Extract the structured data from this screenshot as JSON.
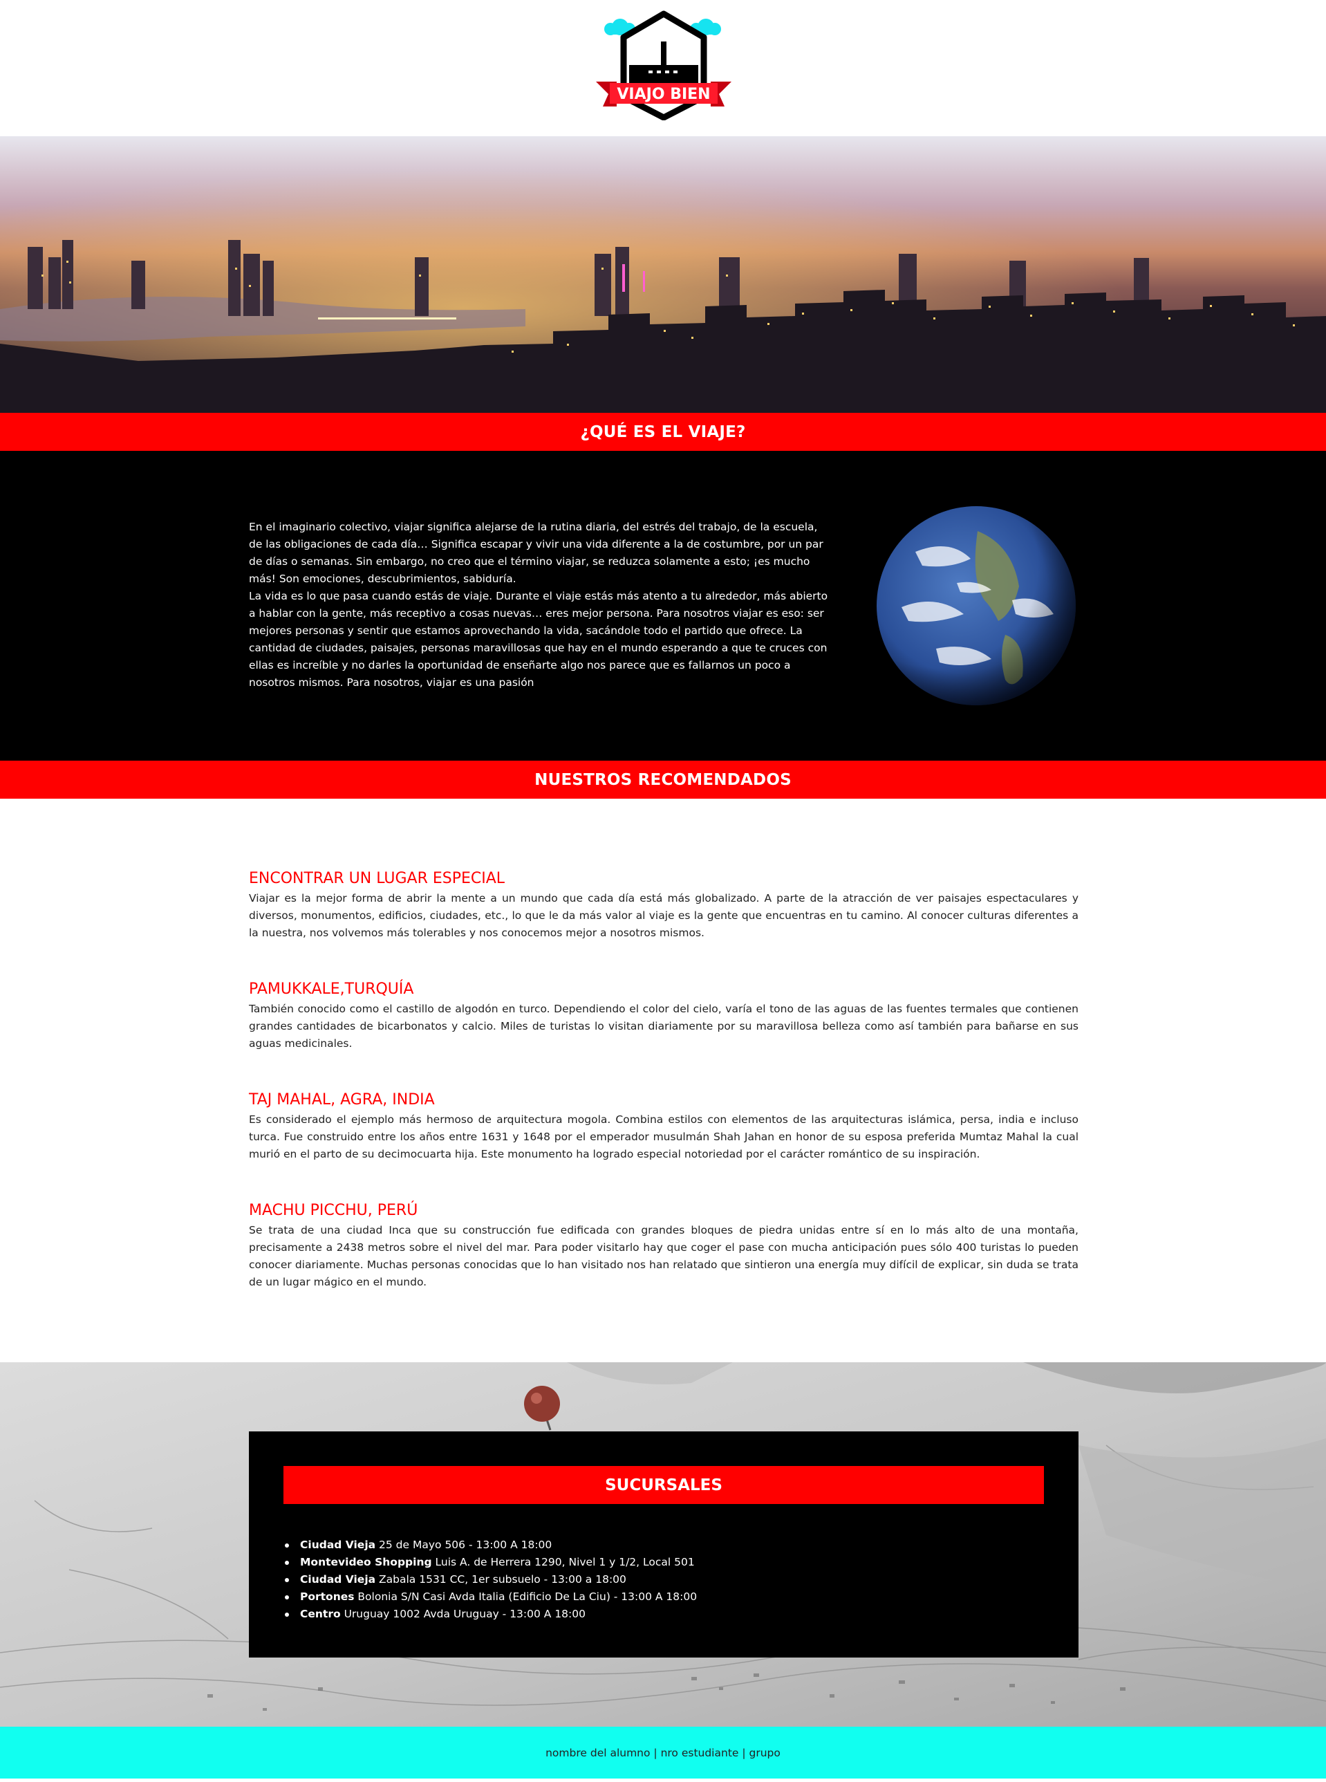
{
  "brand": {
    "name": "VIAJO BIEN",
    "colors": {
      "accent": "#ff0000",
      "footer": "#11fff0",
      "dark": "#000000",
      "cloud": "#16e3f0"
    }
  },
  "hero": {
    "image": "night-city-skyline-image"
  },
  "sections": {
    "que_es": {
      "title": "¿QUÉ ES EL VIAJE?",
      "paragraphs": [
        "En el imaginario colectivo, viajar significa alejarse de la rutina diaria, del estrés del trabajo, de la escuela, de las obligaciones de cada día… Significa escapar y vivir una vida diferente a la de costumbre, por un par de días o semanas. Sin embargo, no creo que el término viajar, se reduzca solamente a esto; ¡es mucho más! Son emociones, descubrimientos, sabiduría.",
        "La vida es lo que pasa cuando estás de viaje. Durante el viaje estás más atento a tu alrededor, más abierto a hablar con la gente, más receptivo a cosas nuevas… eres mejor persona. Para nosotros viajar es eso: ser mejores personas y sentir que estamos aprovechando la vida, sacándole todo el partido que ofrece. La cantidad de ciudades, paisajes, personas maravillosas que hay en el mundo esperando a que te cruces con ellas es increíble y no darles la oportunidad de enseñarte algo nos parece que es fallarnos un poco a nosotros mismos. Para nosotros, viajar es una pasión"
      ],
      "image": "earth-globe-image"
    },
    "recomendados": {
      "title": "NUESTROS RECOMENDADOS",
      "items": [
        {
          "title": "ENCONTRAR UN LUGAR ESPECIAL",
          "text": "Viajar es la mejor forma de abrir la mente a un mundo que cada día está más globalizado. A parte de la atracción de ver paisajes espectaculares y diversos, monumentos, edificios, ciudades, etc., lo que le da más valor al viaje es la gente que encuentras en tu camino. Al conocer culturas diferentes a la nuestra, nos volvemos más tolerables y nos conocemos mejor a nosotros mismos."
        },
        {
          "title": "PAMUKKALE,TURQUÍA",
          "text": "También conocido como el castillo de algodón en turco. Dependiendo el color del cielo, varía el tono de las aguas de las fuentes termales que contienen grandes cantidades de bicarbonatos y calcio. Miles de turistas lo visitan diariamente por su maravillosa belleza como así también para bañarse en sus aguas medicinales."
        },
        {
          "title": "TAJ MAHAL, AGRA, INDIA",
          "text": "Es considerado el ejemplo más hermoso de arquitectura mogola. Combina estilos con elementos de las arquitecturas islámica, persa, india e incluso turca. Fue construido entre los años entre 1631 y 1648 por el emperador musulmán Shah Jahan en honor de su esposa preferida Mumtaz Mahal la cual murió en el parto de su decimocuarta hija. Este monumento ha logrado especial notoriedad por el carácter romántico de su inspiración."
        },
        {
          "title": "MACHU PICCHU, PERÚ",
          "text": "Se trata de una ciudad Inca que su construcción fue edificada con grandes bloques de piedra unidas entre sí en lo más alto de una montaña, precisamente a 2438 metros sobre el nivel del mar. Para poder visitarlo hay que coger el pase con mucha anticipación pues sólo 400 turistas lo pueden conocer diariamente. Muchas personas conocidas que lo han visitado nos han relatado que sintieron una energía muy difícil de explicar, sin duda se trata de un lugar mágico en el mundo."
        }
      ]
    },
    "sucursales": {
      "title": "SUCURSALES",
      "background_image": "map-with-pin-image",
      "items": [
        {
          "name": "Ciudad Vieja",
          "detail": "25 de Mayo 506 - 13:00 A 18:00"
        },
        {
          "name": "Montevideo Shopping",
          "detail": "Luis A. de Herrera 1290, Nivel 1 y 1/2, Local 501"
        },
        {
          "name": "Ciudad Vieja",
          "detail": "Zabala 1531 CC, 1er subsuelo - 13:00 a 18:00"
        },
        {
          "name": "Portones",
          "detail": "Bolonia S/N Casi Avda Italia (Edificio De La Ciu) - 13:00 A 18:00"
        },
        {
          "name": "Centro",
          "detail": "Uruguay 1002 Avda Uruguay - 13:00 A 18:00"
        }
      ]
    }
  },
  "footer": {
    "text": "nombre del alumno | nro estudiante | grupo"
  }
}
